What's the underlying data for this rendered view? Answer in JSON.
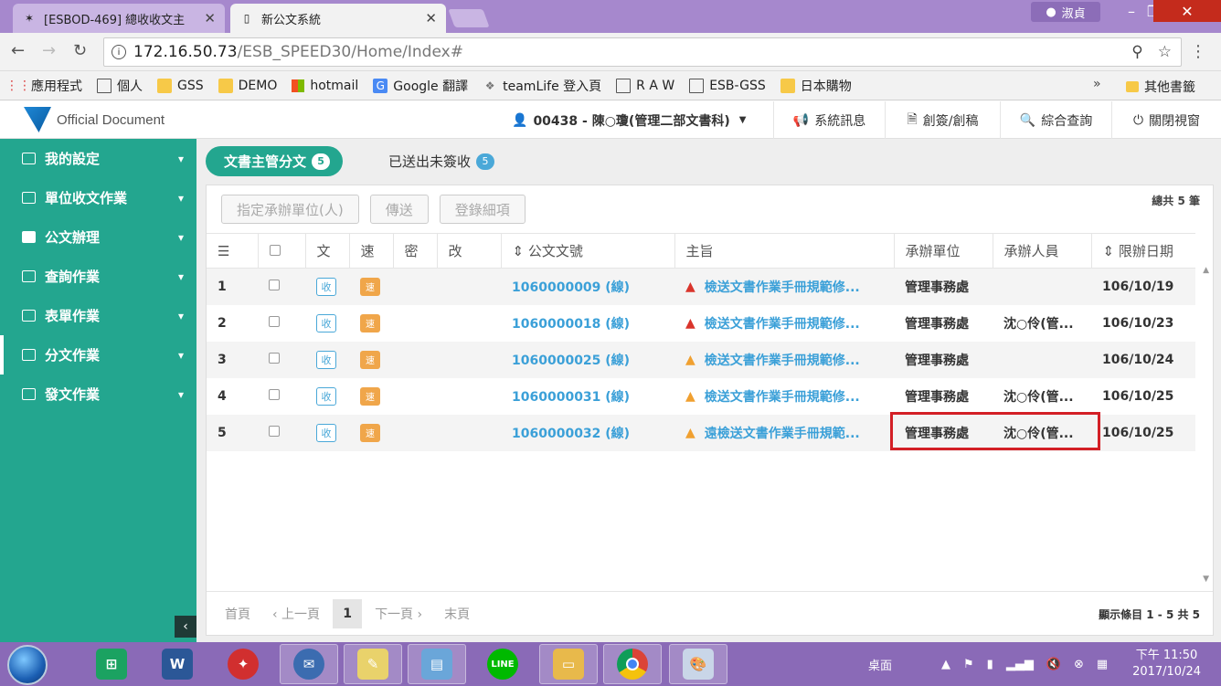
{
  "browser": {
    "tabs": [
      {
        "title": "[ESBOD-469] 總收收文主"
      },
      {
        "title": "新公文系統"
      }
    ],
    "profile_name": "淑貞",
    "url_host": "172.16.50.73",
    "url_path": "/ESB_SPEED30/Home/Index#",
    "bookmarks": [
      "應用程式",
      "個人",
      "GSS",
      "DEMO",
      "hotmail",
      "Google 翻譯",
      "teamLife 登入頁",
      "R A W",
      "ESB-GSS",
      "日本購物"
    ],
    "bookmarks_more": "»",
    "other_bookmarks": "其他書籤"
  },
  "app": {
    "logo_text": "Official Document",
    "user": "00438 - 陳○瓊(管理二部文書科)",
    "header_buttons": [
      "系統訊息",
      "創簽/創稿",
      "綜合查詢",
      "關閉視窗"
    ]
  },
  "sidebar": {
    "items": [
      {
        "label": "我的設定"
      },
      {
        "label": "單位收文作業"
      },
      {
        "label": "公文辦理"
      },
      {
        "label": "查詢作業"
      },
      {
        "label": "表單作業"
      },
      {
        "label": "分文作業"
      },
      {
        "label": "發文作業"
      }
    ]
  },
  "main": {
    "tabs": [
      {
        "label": "文書主管分文",
        "count": "5"
      },
      {
        "label": "已送出未簽收",
        "count": "5"
      }
    ],
    "toolbar": [
      "指定承辦單位(人)",
      "傳送",
      "登錄細項"
    ],
    "total": "總共 5 筆",
    "columns": [
      "文",
      "速",
      "密",
      "改",
      "公文文號",
      "主旨",
      "承辦單位",
      "承辦人員",
      "限辦日期"
    ],
    "rows": [
      {
        "no": "1",
        "recv": "收",
        "speed": "速",
        "doc_no": "1060000009 (線)",
        "subject": "檢送文書作業手冊規範修...",
        "alert": "red",
        "unit": "管理事務處",
        "person": "",
        "deadline": "106/10/19"
      },
      {
        "no": "2",
        "recv": "收",
        "speed": "速",
        "doc_no": "1060000018 (線)",
        "subject": "檢送文書作業手冊規範修...",
        "alert": "red",
        "unit": "管理事務處",
        "person": "沈○伶(管...",
        "deadline": "106/10/23"
      },
      {
        "no": "3",
        "recv": "收",
        "speed": "速",
        "doc_no": "1060000025 (線)",
        "subject": "檢送文書作業手冊規範修...",
        "alert": "yellow",
        "unit": "管理事務處",
        "person": "",
        "deadline": "106/10/24"
      },
      {
        "no": "4",
        "recv": "收",
        "speed": "速",
        "doc_no": "1060000031 (線)",
        "subject": "檢送文書作業手冊規範修...",
        "alert": "yellow",
        "unit": "管理事務處",
        "person": "沈○伶(管...",
        "deadline": "106/10/25"
      },
      {
        "no": "5",
        "recv": "收",
        "speed": "速",
        "doc_no": "1060000032 (線)",
        "subject": "遠檢送文書作業手冊規範...",
        "alert": "yellow",
        "unit": "管理事務處",
        "person": "沈○伶(管...",
        "deadline": "106/10/25"
      }
    ],
    "pager": {
      "first": "首頁",
      "prev": "‹ 上一頁",
      "current": "1",
      "next": "下一頁 ›",
      "last": "末頁",
      "info": "顯示條目 1 - 5 共 5"
    }
  },
  "taskbar": {
    "desktop_label": "桌面",
    "time": "下午 11:50",
    "date": "2017/10/24"
  },
  "colors": {
    "accent": "#23a68f",
    "link": "#3ba0d8",
    "tabbar": "#a688cd",
    "highlight": "#d31f26"
  }
}
